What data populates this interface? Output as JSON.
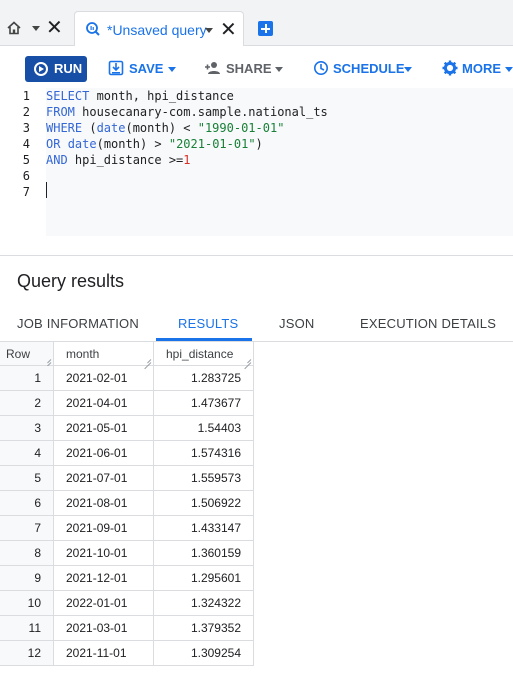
{
  "tabs": {
    "active_label": "*Unsaved query"
  },
  "toolbar": {
    "run": "RUN",
    "save": "SAVE",
    "share": "SHARE",
    "schedule": "SCHEDULE",
    "more": "MORE"
  },
  "editor": {
    "line_numbers": [
      "1",
      "2",
      "3",
      "4",
      "5",
      "6",
      "7"
    ],
    "lines": [
      [
        {
          "t": "SELECT",
          "c": "kw"
        },
        {
          "t": " month, hpi_distance",
          "c": ""
        }
      ],
      [
        {
          "t": "FROM",
          "c": "kw"
        },
        {
          "t": " housecanary-com.sample.national_ts",
          "c": ""
        }
      ],
      [
        {
          "t": "WHERE",
          "c": "kw"
        },
        {
          "t": " (",
          "c": ""
        },
        {
          "t": "date",
          "c": "kw"
        },
        {
          "t": "(month) < ",
          "c": ""
        },
        {
          "t": "\"1990-01-01\"",
          "c": "str"
        }
      ],
      [
        {
          "t": "OR",
          "c": "kw"
        },
        {
          "t": " ",
          "c": ""
        },
        {
          "t": "date",
          "c": "kw"
        },
        {
          "t": "(month) > ",
          "c": ""
        },
        {
          "t": "\"2021-01-01\"",
          "c": "str"
        },
        {
          "t": ")",
          "c": ""
        }
      ],
      [
        {
          "t": "AND",
          "c": "kw"
        },
        {
          "t": " hpi_distance >=",
          "c": ""
        },
        {
          "t": "1",
          "c": "num"
        }
      ],
      [],
      []
    ]
  },
  "results": {
    "title": "Query results",
    "tabs": [
      "JOB INFORMATION",
      "RESULTS",
      "JSON",
      "EXECUTION DETAILS"
    ],
    "active_tab": "RESULTS",
    "columns": [
      "Row",
      "month",
      "hpi_distance"
    ],
    "rows": [
      [
        "1",
        "2021-02-01",
        "1.283725"
      ],
      [
        "2",
        "2021-04-01",
        "1.473677"
      ],
      [
        "3",
        "2021-05-01",
        "1.54403"
      ],
      [
        "4",
        "2021-06-01",
        "1.574316"
      ],
      [
        "5",
        "2021-07-01",
        "1.559573"
      ],
      [
        "6",
        "2021-08-01",
        "1.506922"
      ],
      [
        "7",
        "2021-09-01",
        "1.433147"
      ],
      [
        "8",
        "2021-10-01",
        "1.360159"
      ],
      [
        "9",
        "2021-12-01",
        "1.295601"
      ],
      [
        "10",
        "2022-01-01",
        "1.324322"
      ],
      [
        "11",
        "2021-03-01",
        "1.379352"
      ],
      [
        "12",
        "2021-11-01",
        "1.309254"
      ]
    ]
  },
  "colors": {
    "accent": "#1a73e8",
    "run_button": "#174ea6",
    "keyword": "#3367d6",
    "string": "#188038",
    "number": "#d93025"
  }
}
